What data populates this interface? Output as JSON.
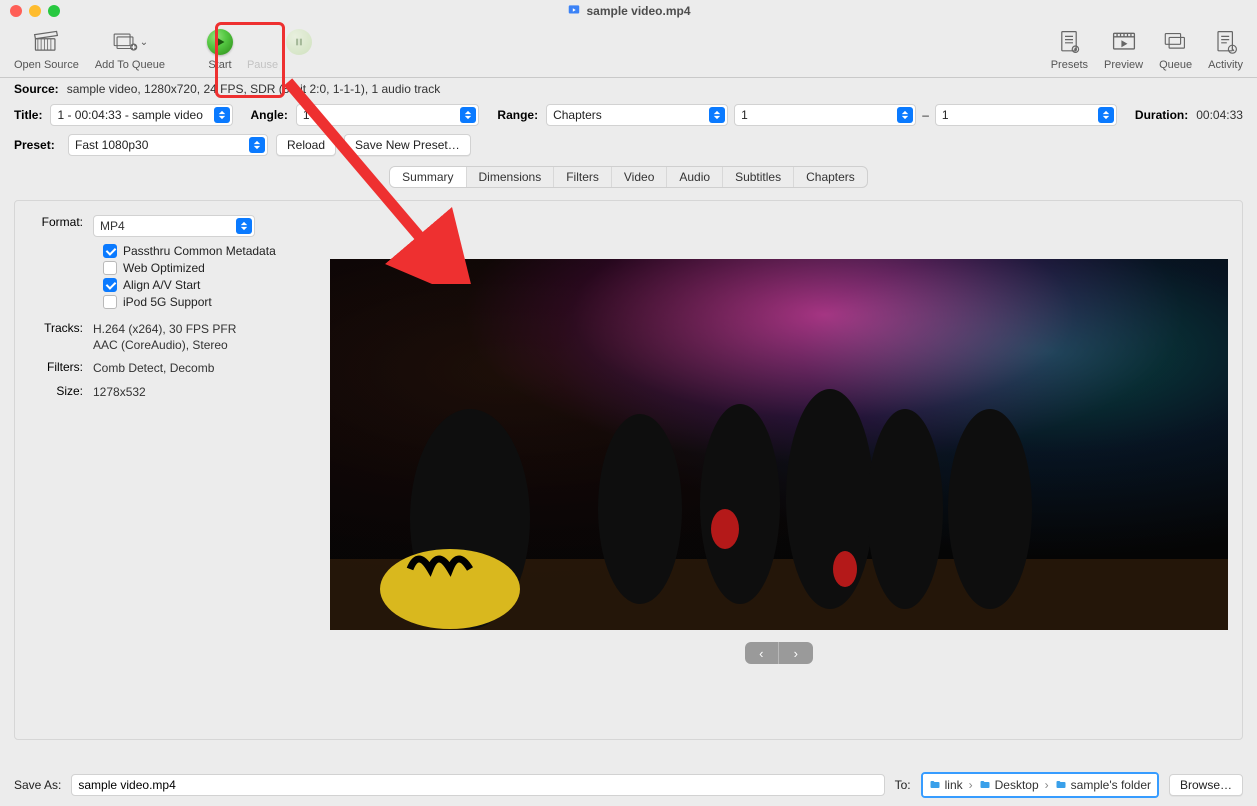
{
  "window": {
    "document_icon": "video-file-icon",
    "title": "sample video.mp4"
  },
  "toolbar": {
    "open_source": "Open Source",
    "add_to_queue": "Add To Queue",
    "start": "Start",
    "pause": "Pause",
    "presets": "Presets",
    "preview": "Preview",
    "queue": "Queue",
    "activity": "Activity"
  },
  "source": {
    "label": "Source:",
    "value": "sample video, 1280x720, 24 FPS, SDR (8-bit 2:0, 1-1-1), 1 audio track"
  },
  "title_row": {
    "label": "Title:",
    "selected": "1 - 00:04:33 - sample video",
    "angle_label": "Angle:",
    "angle": "1",
    "range_label": "Range:",
    "range_type": "Chapters",
    "range_from": "1",
    "range_sep": "–",
    "range_to": "1",
    "duration_label": "Duration:",
    "duration": "00:04:33"
  },
  "preset_row": {
    "label": "Preset:",
    "selected": "Fast 1080p30",
    "reload": "Reload",
    "save_new": "Save New Preset…"
  },
  "tabs": [
    "Summary",
    "Dimensions",
    "Filters",
    "Video",
    "Audio",
    "Subtitles",
    "Chapters"
  ],
  "summary": {
    "format_label": "Format:",
    "format": "MP4",
    "checkboxes": {
      "passthru": {
        "label": "Passthru Common Metadata",
        "checked": true
      },
      "web": {
        "label": "Web Optimized",
        "checked": false
      },
      "align": {
        "label": "Align A/V Start",
        "checked": true
      },
      "ipod": {
        "label": "iPod 5G Support",
        "checked": false
      }
    },
    "tracks_label": "Tracks:",
    "tracks_line1": "H.264 (x264), 30 FPS PFR",
    "tracks_line2": "AAC (CoreAudio), Stereo",
    "filters_label": "Filters:",
    "filters_value": "Comb Detect, Decomb",
    "size_label": "Size:",
    "size_value": "1278x532"
  },
  "save": {
    "save_as_label": "Save As:",
    "filename": "sample video.mp4",
    "to_label": "To:",
    "breadcrumbs": [
      "link",
      "Desktop",
      "sample's folder"
    ],
    "browse": "Browse…"
  }
}
